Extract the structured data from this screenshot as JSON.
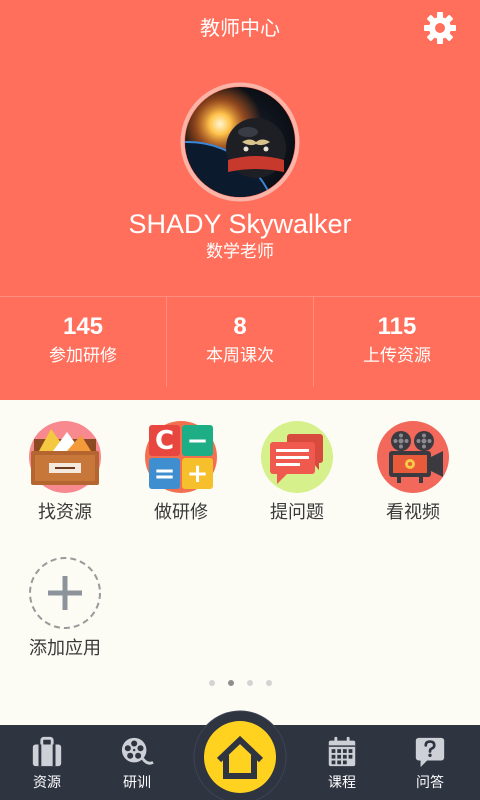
{
  "header": {
    "title": "教师中心",
    "settings_icon": "gear-icon"
  },
  "theme": {
    "primary": "#FF6F5B",
    "background": "#FCFCF5",
    "tabbar": "#2F3441",
    "home_accent": "#FFD21F"
  },
  "profile": {
    "name": "SHADY Skywalker",
    "role": "数学老师",
    "avatar_icon": "avatar-image"
  },
  "stats": [
    {
      "value": "145",
      "label": "参加研修"
    },
    {
      "value": "8",
      "label": "本周课次"
    },
    {
      "value": "115",
      "label": "上传资源"
    }
  ],
  "apps": [
    {
      "label": "找资源",
      "icon": "resource-box-icon",
      "color": "#F7898F"
    },
    {
      "label": "做研修",
      "icon": "calculator-icon",
      "color": "#F2704F",
      "keys": [
        "C",
        "−",
        "=",
        "+"
      ]
    },
    {
      "label": "提问题",
      "icon": "chat-bubbles-icon",
      "color": "#D6F08C"
    },
    {
      "label": "看视频",
      "icon": "video-camera-icon",
      "color": "#F2685A"
    },
    {
      "label": "添加应用",
      "icon": "add-icon"
    }
  ],
  "pager": {
    "total": 4,
    "current": 2
  },
  "tabbar": {
    "items": [
      {
        "label": "资源",
        "icon": "suitcase-icon"
      },
      {
        "label": "研训",
        "icon": "film-reel-icon"
      },
      {
        "icon": "home-icon"
      },
      {
        "label": "课程",
        "icon": "calendar-icon"
      },
      {
        "label": "问答",
        "icon": "question-bubble-icon"
      }
    ]
  }
}
